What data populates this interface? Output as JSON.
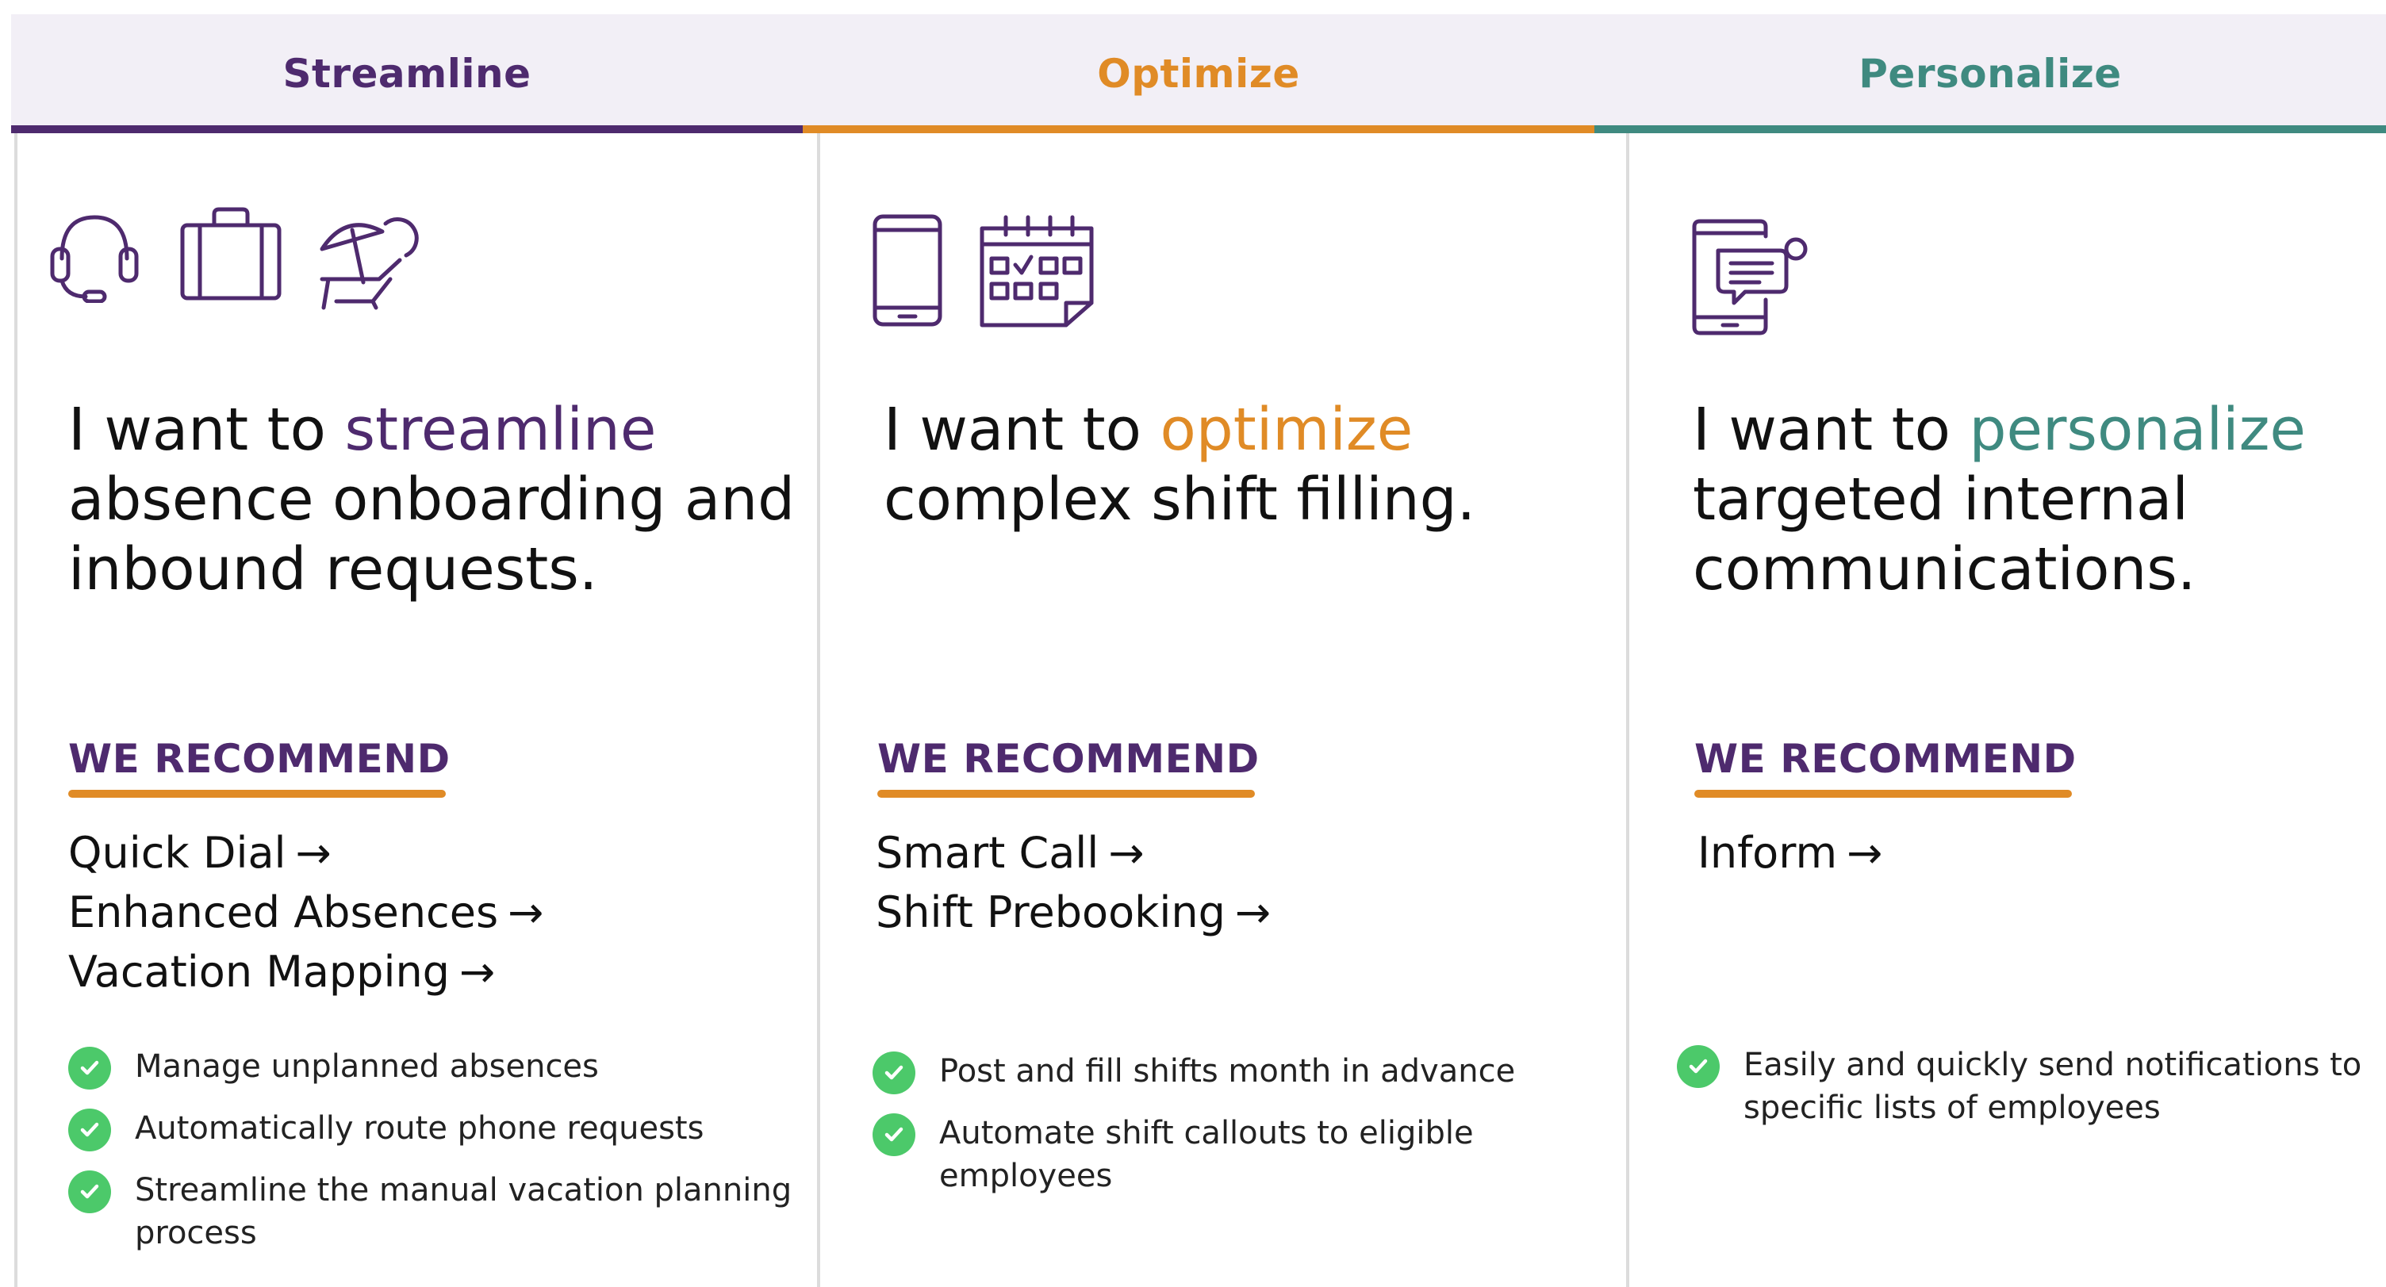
{
  "colors": {
    "purple": "#4e2a6e",
    "orange": "#e08b26",
    "teal": "#3f8a80",
    "check_green": "#4cc96a",
    "tab_bg": "#f2eff6"
  },
  "tabs": [
    {
      "label": "Streamline"
    },
    {
      "label": "Optimize"
    },
    {
      "label": "Personalize"
    }
  ],
  "columns": [
    {
      "icons": [
        "headset-icon",
        "briefcase-icon",
        "beach-chair-icon"
      ],
      "headline_prefix": "I want to ",
      "headline_accent": "streamline",
      "headline_rest": "absence onboarding and inbound requests.",
      "recommend_label": "WE RECOMMEND",
      "links": [
        "Quick Dial",
        "Enhanced Absences",
        "Vacation Mapping"
      ],
      "arrow": "→",
      "features": [
        "Manage unplanned absences",
        "Automatically route phone requests",
        "Streamline the manual vacation planning process"
      ]
    },
    {
      "icons": [
        "smartphone-icon",
        "calendar-check-icon"
      ],
      "headline_prefix": "I want to ",
      "headline_accent": "optimize",
      "headline_rest": "complex shift filling.",
      "recommend_label": "WE RECOMMEND",
      "links": [
        "Smart Call",
        "Shift Prebooking"
      ],
      "arrow": "→",
      "features": [
        "Post and fill shifts month in advance",
        "Automate shift callouts to eligible employees"
      ]
    },
    {
      "icons": [
        "tablet-message-icon"
      ],
      "headline_prefix": "I want to ",
      "headline_accent": "personalize",
      "headline_rest": "targeted internal communications.",
      "recommend_label": "WE RECOMMEND",
      "links": [
        "Inform"
      ],
      "arrow": "→",
      "features": [
        "Easily and quickly send notifications to specific lists of employees"
      ]
    }
  ]
}
